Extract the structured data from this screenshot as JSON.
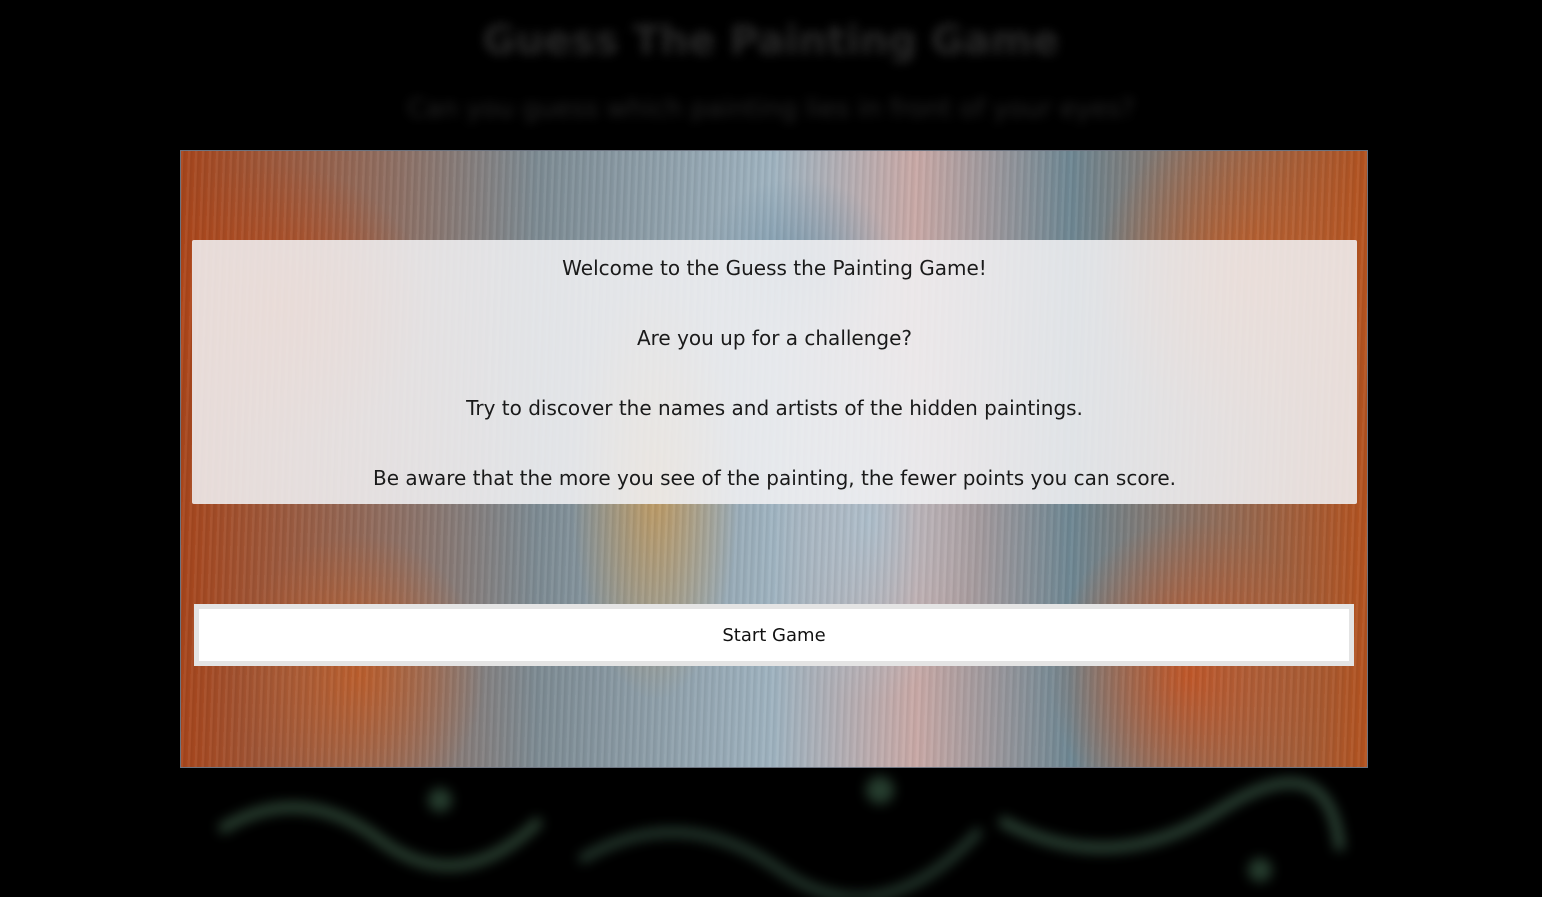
{
  "page": {
    "title": "Guess The Painting Game",
    "subtitle": "Can you guess which painting lies in front of your eyes?"
  },
  "modal": {
    "intro_lines": [
      "Welcome to the Guess the Painting Game!",
      "Are you up for a challenge?",
      "Try to discover the names and artists of the hidden paintings.",
      "Be aware that the more you see of the painting, the fewer points you can score."
    ],
    "start_button_label": "Start Game"
  },
  "colors": {
    "overlay": "#000000",
    "intro_background": "#f0f0f2",
    "button_background": "#ffffff",
    "text": "#1a1a1a"
  }
}
